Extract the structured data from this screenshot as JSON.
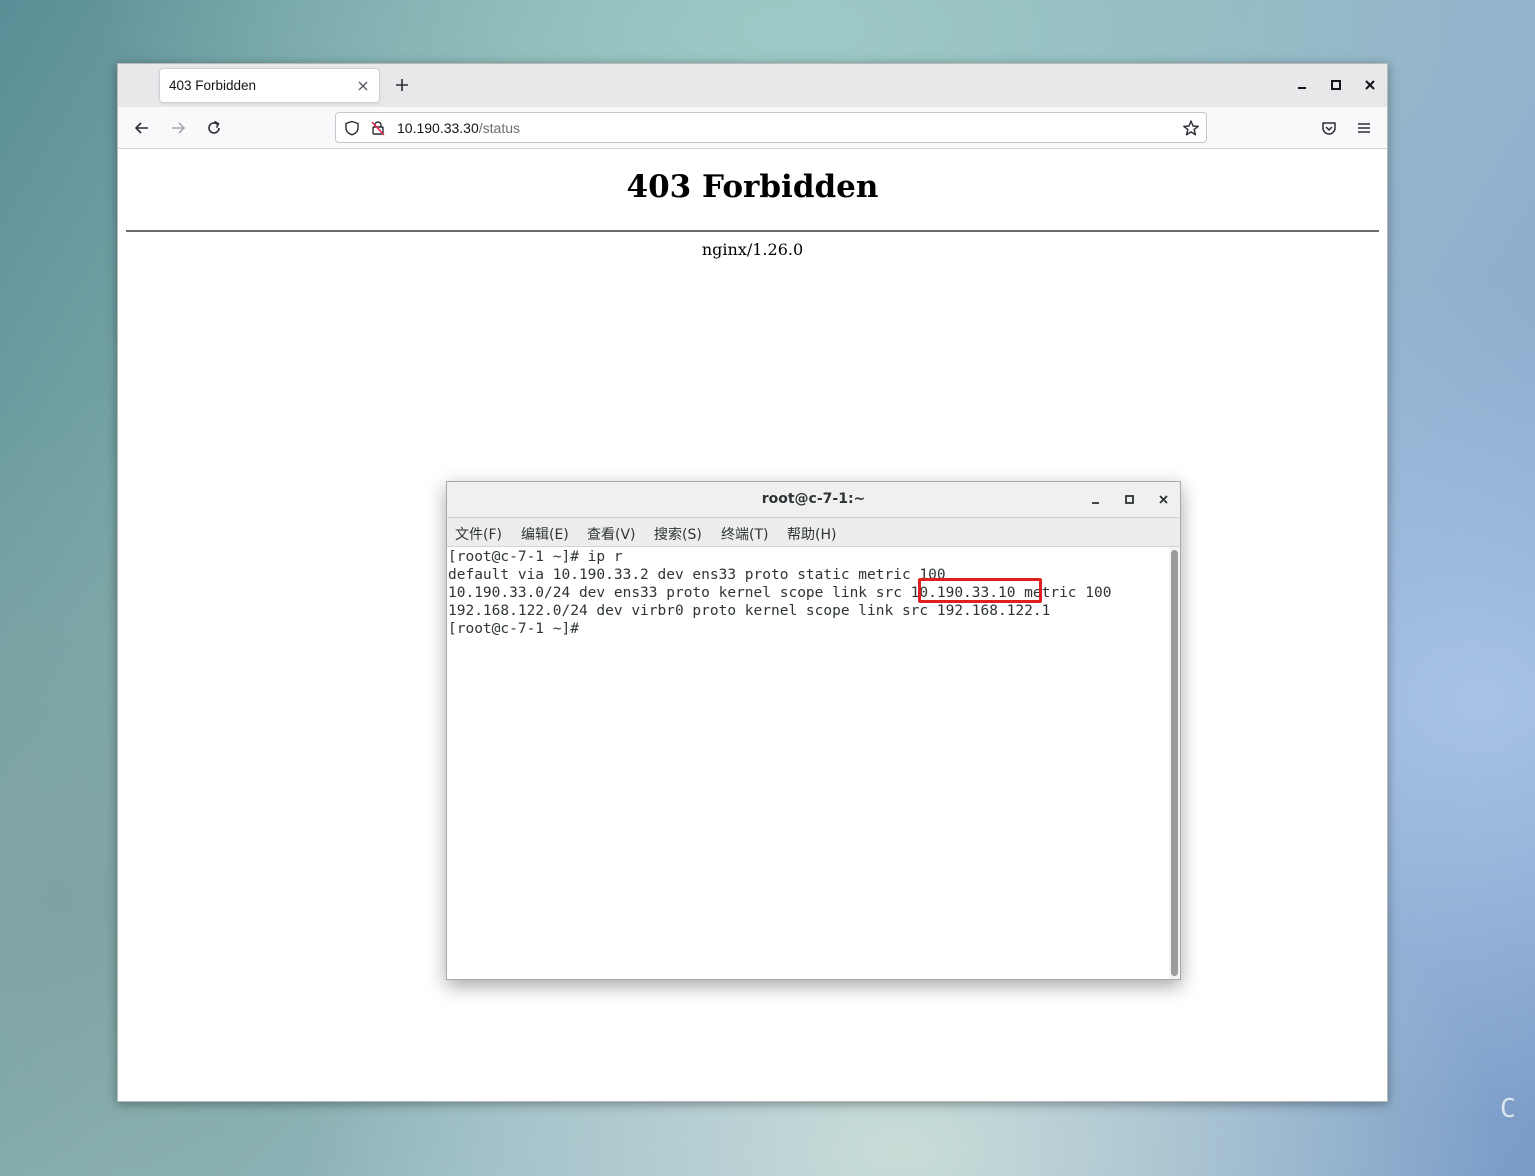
{
  "browser": {
    "tab": {
      "title": "403 Forbidden"
    },
    "url": {
      "host": "10.190.33.30",
      "path": "/status"
    },
    "page": {
      "heading": "403 Forbidden",
      "server": "nginx/1.26.0"
    }
  },
  "terminal": {
    "title": "root@c-7-1:~",
    "menu": [
      "文件(F)",
      "编辑(E)",
      "查看(V)",
      "搜索(S)",
      "终端(T)",
      "帮助(H)"
    ],
    "lines": [
      "[root@c-7-1 ~]# ip r",
      "default via 10.190.33.2 dev ens33 proto static metric 100",
      "10.190.33.0/24 dev ens33 proto kernel scope link src 10.190.33.10 metric 100",
      "192.168.122.0/24 dev virbr0 proto kernel scope link src 192.168.122.1",
      "[root@c-7-1 ~]#"
    ],
    "highlight_color": "#e02020"
  },
  "desktop": {
    "corner_text": "C"
  }
}
